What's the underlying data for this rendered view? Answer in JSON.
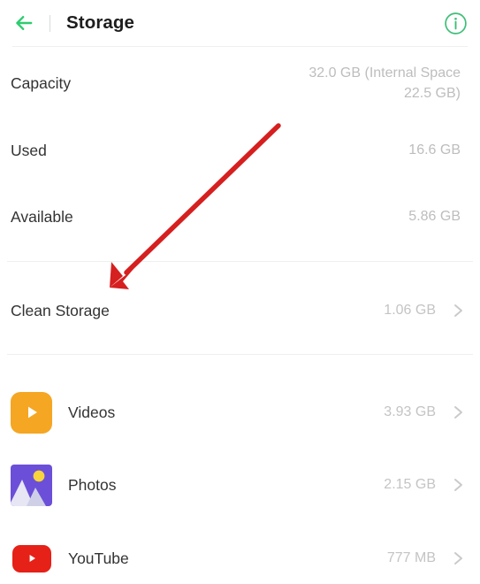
{
  "header": {
    "back_icon": "back-arrow-icon",
    "title": "Storage",
    "info_icon": "info-circle-icon",
    "accent_color": "#2ECC71"
  },
  "info_rows": [
    {
      "label": "Capacity",
      "value": "32.0 GB (Internal Space\n22.5 GB)"
    },
    {
      "label": "Used",
      "value": "16.6 GB"
    },
    {
      "label": "Available",
      "value": "5.86 GB"
    }
  ],
  "clean_storage": {
    "label": "Clean Storage",
    "value": "1.06 GB",
    "chevron_icon": "chevron-right-icon"
  },
  "apps": [
    {
      "label": "Videos",
      "value": "3.93 GB",
      "icon": "videos-play-icon",
      "icon_color": "#F5A623",
      "chevron_icon": "chevron-right-icon"
    },
    {
      "label": "Photos",
      "value": "2.15 GB",
      "icon": "photos-image-icon",
      "icon_color": "#6B4FD8",
      "chevron_icon": "chevron-right-icon"
    },
    {
      "label": "YouTube",
      "value": "777 MB",
      "icon": "youtube-play-icon",
      "icon_color": "#E62117",
      "chevron_icon": "chevron-right-icon"
    }
  ],
  "annotation": {
    "type": "arrow",
    "color": "#D61F1F",
    "points_to": "Clean Storage"
  }
}
